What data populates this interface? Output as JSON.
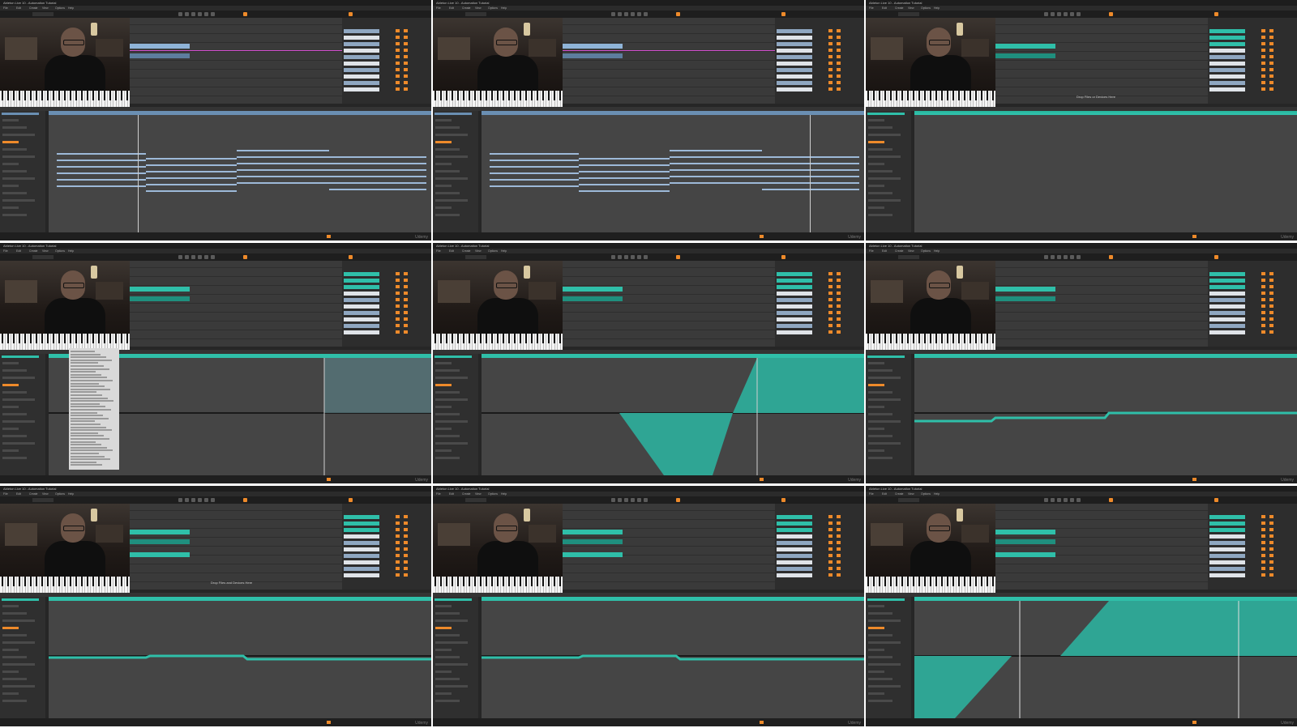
{
  "screenshot": {
    "title": "Ableton Live 10 - Automation Tutorial",
    "watermark": "Udemy",
    "menu": [
      "File",
      "Edit",
      "Create",
      "View",
      "Options",
      "Help"
    ]
  },
  "panels": [
    {
      "id": 1,
      "mode": "midi",
      "accent": "#6a8fb3",
      "popup": false
    },
    {
      "id": 2,
      "mode": "midi",
      "accent": "#6a8fb3",
      "popup": false
    },
    {
      "id": 3,
      "mode": "clip",
      "accent": "#2fbfa9",
      "popup": false,
      "overlay_text": "Drop Files or Devices Here"
    },
    {
      "id": 4,
      "mode": "automation",
      "accent": "#2fbfa9",
      "popup": true
    },
    {
      "id": 5,
      "mode": "automation-envelope",
      "accent": "#2fbfa9",
      "popup": false
    },
    {
      "id": 6,
      "mode": "automation-flat",
      "accent": "#2fbfa9",
      "popup": false
    },
    {
      "id": 7,
      "mode": "automation-flat",
      "accent": "#2fbfa9",
      "popup": false,
      "overlay_text": "Drop Files and Devices Here"
    },
    {
      "id": 8,
      "mode": "automation-flat",
      "accent": "#2fbfa9",
      "popup": false
    },
    {
      "id": 9,
      "mode": "automation-envelope2",
      "accent": "#2fbfa9",
      "popup": false
    }
  ]
}
